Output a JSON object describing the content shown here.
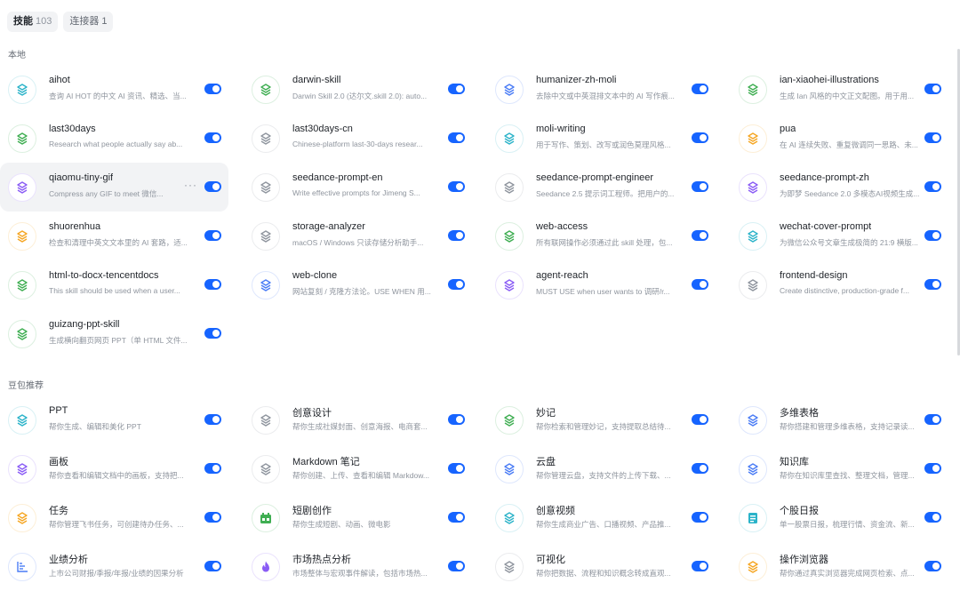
{
  "tabs": [
    {
      "label": "技能",
      "count": "103"
    },
    {
      "label": "连接器",
      "count": "1"
    }
  ],
  "sections": [
    {
      "title": "本地",
      "items": [
        {
          "name": "aihot",
          "desc": "查询 AI HOT 的中文 AI 资讯、精选、当...",
          "color": "#2bb3c9",
          "icon": "layers-icon"
        },
        {
          "name": "darwin-skill",
          "desc": "Darwin Skill 2.0 (达尔文.skill 2.0): auto...",
          "color": "#3fae52",
          "icon": "layers-icon"
        },
        {
          "name": "humanizer-zh-moli",
          "desc": "去除中文或中英混排文本中的 AI 写作痕...",
          "color": "#4a7cf5",
          "icon": "layers-icon"
        },
        {
          "name": "ian-xiaohei-illustrations",
          "desc": "生成 Ian 风格的中文正文配图。用于用...",
          "color": "#3fae52",
          "icon": "layers-icon"
        },
        {
          "name": "last30days",
          "desc": "Research what people actually say ab...",
          "color": "#3fae52",
          "icon": "layers-icon"
        },
        {
          "name": "last30days-cn",
          "desc": "Chinese-platform last-30-days resear...",
          "color": "#8f959e",
          "icon": "layers-icon"
        },
        {
          "name": "moli-writing",
          "desc": "用于写作、策划、改写或润色莫理风格...",
          "color": "#2bb3c9",
          "icon": "layers-icon"
        },
        {
          "name": "pua",
          "desc": "在 AI 连续失败、重复微调同一思路、未...",
          "color": "#f5a623",
          "icon": "layers-icon"
        },
        {
          "name": "qiaomu-tiny-gif",
          "desc": "Compress any GIF to meet 微信...",
          "color": "#8a5cf5",
          "icon": "layers-icon"
        },
        {
          "name": "seedance-prompt-en",
          "desc": "Write effective prompts for Jimeng S...",
          "color": "#8f959e",
          "icon": "layers-icon"
        },
        {
          "name": "seedance-prompt-engineer",
          "desc": "Seedance 2.5 提示词工程师。把用户的...",
          "color": "#8f959e",
          "icon": "layers-icon"
        },
        {
          "name": "seedance-prompt-zh",
          "desc": "为即梦 Seedance 2.0 多模态AI视频生成...",
          "color": "#8a5cf5",
          "icon": "layers-icon"
        },
        {
          "name": "shuorenhua",
          "desc": "检查和清理中英文文本里的 AI 套路，适...",
          "color": "#f5a623",
          "icon": "layers-icon"
        },
        {
          "name": "storage-analyzer",
          "desc": "macOS / Windows 只读存储分析助手...",
          "color": "#8f959e",
          "icon": "layers-icon"
        },
        {
          "name": "web-access",
          "desc": "所有联网操作必须通过此 skill 处理，包...",
          "color": "#3fae52",
          "icon": "layers-icon"
        },
        {
          "name": "wechat-cover-prompt",
          "desc": "为微信公众号文章生成极简的 21:9 横版...",
          "color": "#2bb3c9",
          "icon": "layers-icon"
        },
        {
          "name": "html-to-docx-tencentdocs",
          "desc": "This skill should be used when a user...",
          "color": "#3fae52",
          "icon": "layers-icon"
        },
        {
          "name": "web-clone",
          "desc": "网站复刻 / 克隆方法论。USE WHEN 用...",
          "color": "#4a7cf5",
          "icon": "layers-icon"
        },
        {
          "name": "agent-reach",
          "desc": "MUST USE when user wants to 调研/r...",
          "color": "#8a5cf5",
          "icon": "layers-icon"
        },
        {
          "name": "frontend-design",
          "desc": "Create distinctive, production-grade f...",
          "color": "#8f959e",
          "icon": "layers-icon"
        },
        {
          "name": "guizang-ppt-skill",
          "desc": "生成横向翻页网页 PPT（单 HTML 文件...",
          "color": "#3fae52",
          "icon": "layers-icon"
        }
      ]
    },
    {
      "title": "豆包推荐",
      "items": [
        {
          "name": "PPT",
          "desc": "帮你生成、编辑和美化 PPT",
          "color": "#2bb3c9",
          "icon": "layers-icon"
        },
        {
          "name": "创意设计",
          "desc": "帮你生成社媒封面、创意海报、电商套...",
          "color": "#8f959e",
          "icon": "layers-icon"
        },
        {
          "name": "妙记",
          "desc": "帮你检索和管理妙记，支持提取总结待...",
          "color": "#3fae52",
          "icon": "layers-icon"
        },
        {
          "name": "多维表格",
          "desc": "帮你搭建和管理多维表格，支持记录读...",
          "color": "#4a7cf5",
          "icon": "layers-icon"
        },
        {
          "name": "画板",
          "desc": "帮你查看和编辑文档中的画板，支持把...",
          "color": "#8a5cf5",
          "icon": "layers-icon"
        },
        {
          "name": "Markdown 笔记",
          "desc": "帮你创建、上传、查看和编辑 Markdow...",
          "color": "#8f959e",
          "icon": "layers-icon"
        },
        {
          "name": "云盘",
          "desc": "帮你管理云盘，支持文件的上传下载、...",
          "color": "#4a7cf5",
          "icon": "layers-icon"
        },
        {
          "name": "知识库",
          "desc": "帮你在知识库里查找、整理文档，管理...",
          "color": "#4a7cf5",
          "icon": "layers-icon"
        },
        {
          "name": "任务",
          "desc": "帮你管理飞书任务，可创建待办任务、...",
          "color": "#f5a623",
          "icon": "layers-icon"
        },
        {
          "name": "短剧创作",
          "desc": "帮你生成短剧、动画、微电影",
          "color": "#3fae52",
          "icon": "film-icon"
        },
        {
          "name": "创意视频",
          "desc": "帮你生成商业广告、口播视频、产品推...",
          "color": "#2bb3c9",
          "icon": "layers-icon"
        },
        {
          "name": "个股日报",
          "desc": "单一股票日报，梳理行情、资金流、新...",
          "color": "#2bb3c9",
          "icon": "report-icon"
        },
        {
          "name": "业绩分析",
          "desc": "上市公司财报/季报/年报/业绩的因果分析",
          "color": "#4a7cf5",
          "icon": "chart-icon"
        },
        {
          "name": "市场热点分析",
          "desc": "市场整体与宏观事件解读，包括市场热...",
          "color": "#8a5cf5",
          "icon": "flame-icon"
        },
        {
          "name": "可视化",
          "desc": "帮你把数据、流程和知识概念转成直观...",
          "color": "#8f959e",
          "icon": "layers-icon"
        },
        {
          "name": "操作浏览器",
          "desc": "帮你通过真实浏览器完成网页检索、点...",
          "color": "#f5a623",
          "icon": "layers-icon"
        }
      ]
    }
  ]
}
